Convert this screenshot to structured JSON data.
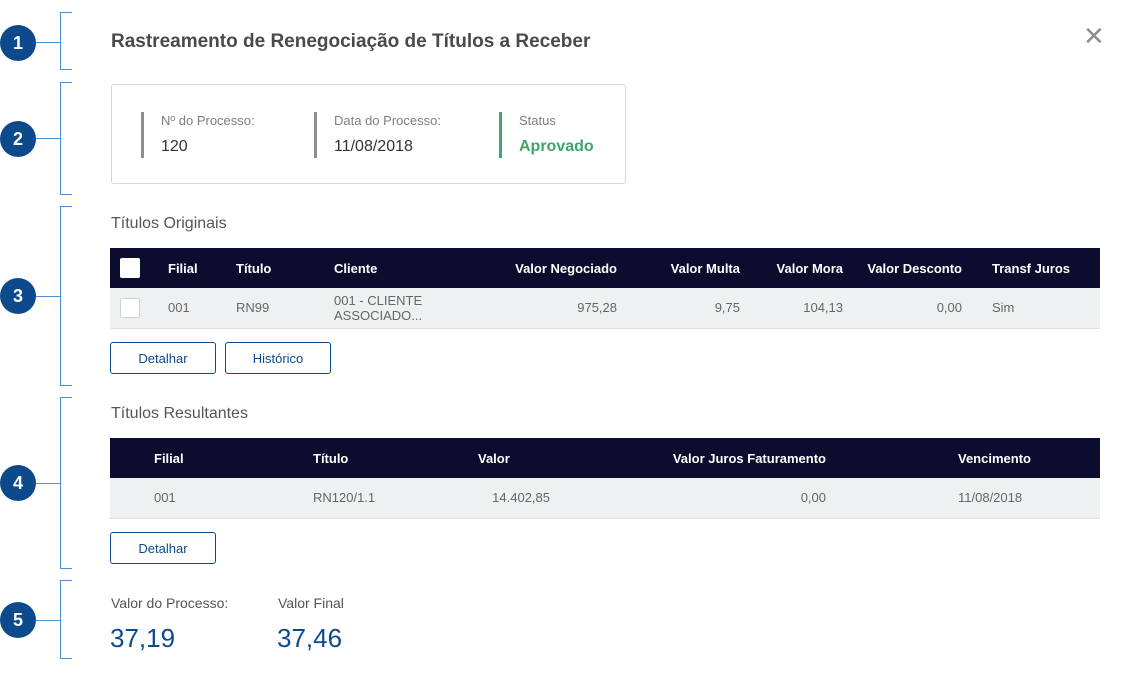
{
  "annotations": [
    "1",
    "2",
    "3",
    "4",
    "5"
  ],
  "title": "Rastreamento de Renegociação de Títulos a Receber",
  "process": {
    "number_label": "Nº do Processo:",
    "number_value": "120",
    "date_label": "Data do Processo:",
    "date_value": "11/08/2018",
    "status_label": "Status",
    "status_value": "Aprovado",
    "status_color": "#3da66b"
  },
  "originais": {
    "title": "Títulos Originais",
    "headers": [
      "Filial",
      "Título",
      "Cliente",
      "Valor Negociado",
      "Valor Multa",
      "Valor Mora",
      "Valor Desconto",
      "Transf Juros"
    ],
    "rows": [
      [
        "001",
        "RN99",
        "001 - CLIENTE ASSOCIADO...",
        "975,28",
        "9,75",
        "104,13",
        "0,00",
        "Sim"
      ]
    ],
    "detalhar_label": "Detalhar",
    "historico_label": "Histórico"
  },
  "resultantes": {
    "title": "Títulos Resultantes",
    "headers": [
      "Filial",
      "Título",
      "Valor",
      "Valor Juros Faturamento",
      "Vencimento"
    ],
    "rows": [
      [
        "001",
        "RN120/1.1",
        "14.402,85",
        "0,00",
        "11/08/2018"
      ]
    ],
    "detalhar_label": "Detalhar"
  },
  "totals": {
    "processo_label": "Valor do Processo:",
    "processo_value": "37,19",
    "final_label": "Valor Final",
    "final_value": "37,46"
  },
  "colors": {
    "accent": "#0c4a8c",
    "header_bg": "#0c0d2e",
    "approved": "#3da66b"
  },
  "icons": {
    "close": "close-icon",
    "checkbox": "checkbox-icon"
  }
}
